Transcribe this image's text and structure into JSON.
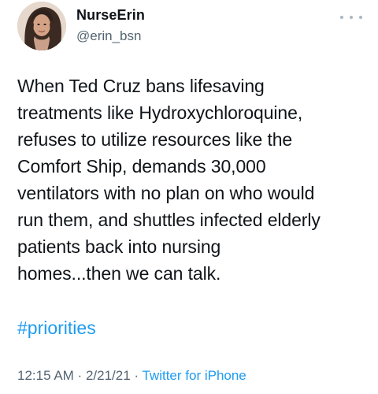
{
  "author": {
    "display_name": "NurseErin",
    "handle": "@erin_bsn"
  },
  "icons": {
    "more": "more-horizontal-icon",
    "avatar": "profile-photo"
  },
  "tweet": {
    "lines": [
      "When Ted Cruz bans lifesaving",
      "treatments like Hydroxychloroquine,",
      "refuses to utilize resources like the",
      "Comfort Ship, demands 30,000",
      "ventilators with no plan on who would",
      "run them, and shuttles infected elderly",
      "patients back into nursing",
      "homes...then we can talk."
    ],
    "hashtag": "#priorities"
  },
  "meta": {
    "time": "12:15 AM",
    "separator": " · ",
    "date": "2/21/21",
    "separator2": " · ",
    "source": "Twitter for iPhone"
  },
  "colors": {
    "link": "#1d9bf0",
    "secondary_text": "#536471",
    "primary_text": "#0f1419"
  }
}
